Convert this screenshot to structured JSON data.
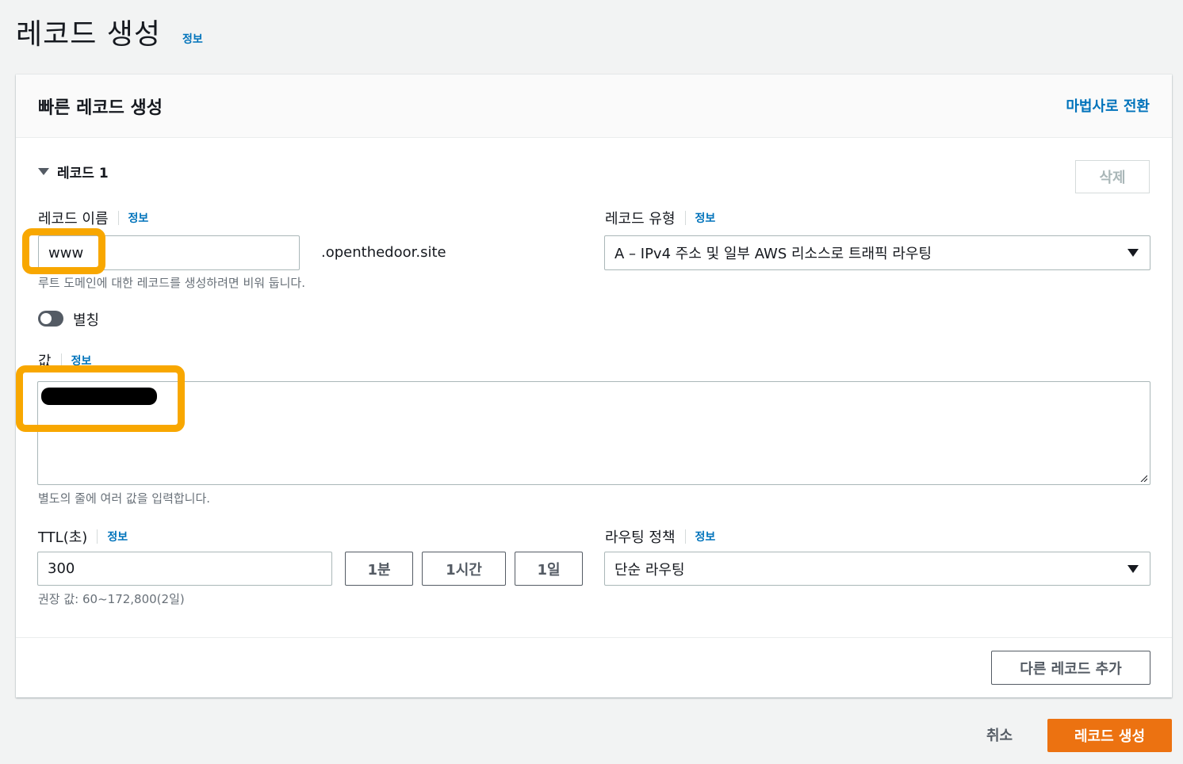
{
  "header": {
    "title": "레코드 생성",
    "info": "정보"
  },
  "panel": {
    "title": "빠른 레코드 생성",
    "wizard_link": "마법사로 전환"
  },
  "record": {
    "section_label": "레코드 1",
    "delete_label": "삭제",
    "name": {
      "label": "레코드 이름",
      "info": "정보",
      "value": "www",
      "domain_suffix": ".openthedoor.site",
      "hint": "루트 도메인에 대한 레코드를 생성하려면 비워 둡니다."
    },
    "type": {
      "label": "레코드 유형",
      "info": "정보",
      "value": "A – IPv4 주소 및 일부 AWS 리소스로 트래픽 라우팅"
    },
    "alias": {
      "label": "별칭",
      "enabled": false
    },
    "value": {
      "label": "값",
      "info": "정보",
      "hint": "별도의 줄에 여러 값을 입력합니다."
    },
    "ttl": {
      "label": "TTL(초)",
      "info": "정보",
      "value": "300",
      "presets": [
        "1분",
        "1시간",
        "1일"
      ],
      "hint": "권장 값: 60~172,800(2일)"
    },
    "routing": {
      "label": "라우팅 정책",
      "info": "정보",
      "value": "단순 라우팅"
    }
  },
  "add_record_label": "다른 레코드 추가",
  "footer": {
    "cancel_label": "취소",
    "submit_label": "레코드 생성"
  },
  "colors": {
    "primary": "#ec7211",
    "link": "#0073bb",
    "highlight": "#f8a700"
  }
}
